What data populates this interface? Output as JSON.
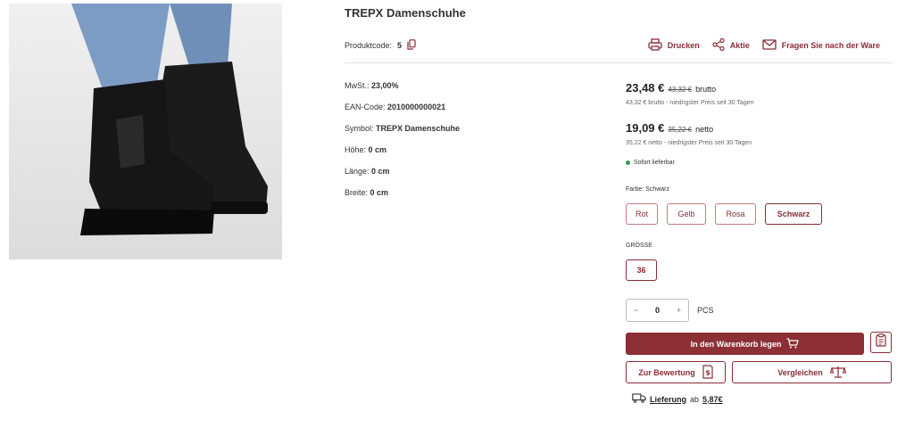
{
  "product": {
    "title": "TREPX Damenschuhe",
    "code_label": "Produktcode:",
    "code_value": "5"
  },
  "actions": {
    "print": "Drucken",
    "promo": "Aktie",
    "ask": "Fragen Sie nach der Ware"
  },
  "specs": [
    {
      "label": "MwSt.:",
      "value": "23,00%"
    },
    {
      "label": "EAN-Code:",
      "value": "2010000000021"
    },
    {
      "label": "Symbol:",
      "value": "TREPX Damenschuhe"
    },
    {
      "label": "Höhe:",
      "value": "0 cm"
    },
    {
      "label": "Länge:",
      "value": "0 cm"
    },
    {
      "label": "Breite:",
      "value": "0 cm"
    }
  ],
  "pricing": {
    "gross_price": "23,48 €",
    "gross_old": "43,32 €",
    "gross_unit": "brutto",
    "gross_note": "43,32 € brutto - niedrigster Preis seit 30 Tagen",
    "net_price": "19,09 €",
    "net_old": "35,22 €",
    "net_unit": "netto",
    "net_note": "35,22 € netto - niedrigster Preis seit 30 Tagen",
    "stock": "Sofort lieferbar",
    "stock_color": "#2e9e4f"
  },
  "color": {
    "label": "Farbe: Schwarz",
    "options": [
      "Rot",
      "Gelb",
      "Rosa",
      "Schwarz"
    ],
    "selected": "Schwarz"
  },
  "size": {
    "label": "GRÖSSE",
    "options": [
      "36"
    ]
  },
  "quantity": {
    "minus": "−",
    "value": "0",
    "plus": "+",
    "unit": "PCS"
  },
  "buttons": {
    "add_to_cart": "In den Warenkorb legen",
    "review": "Zur Bewertung",
    "compare": "Vergleichen"
  },
  "delivery": {
    "link": "Lieferung",
    "ab": "ab",
    "price": "5,87€"
  },
  "colors": {
    "accent": "#8a2d36",
    "cart_bg": "#8c3035"
  },
  "icons": {
    "copy": "copy-icon",
    "print": "printer-icon",
    "share": "share-icon",
    "mail": "envelope-icon",
    "cart": "cart-icon",
    "clipboard": "clipboard-icon",
    "review": "receipt-icon",
    "compare": "scale-icon",
    "truck": "truck-icon"
  }
}
